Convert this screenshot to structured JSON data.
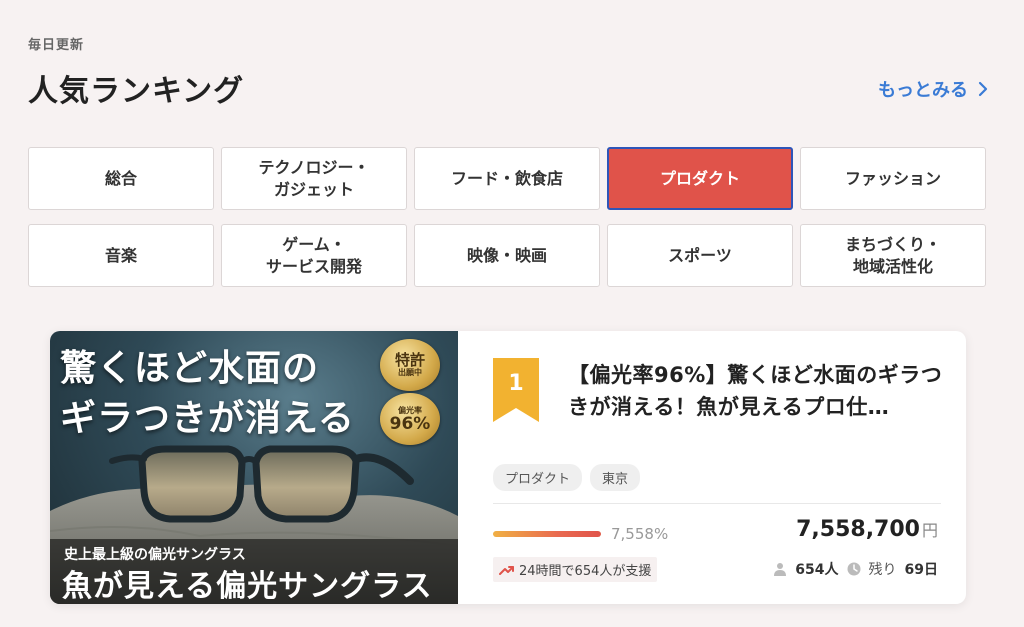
{
  "header": {
    "subtitle": "毎日更新",
    "title": "人気ランキング",
    "more_label": "もっとみる"
  },
  "categories": [
    {
      "label": "総合",
      "active": false
    },
    {
      "label": "テクノロジー・\nガジェット",
      "active": false
    },
    {
      "label": "フード・飲食店",
      "active": false
    },
    {
      "label": "プロダクト",
      "active": true
    },
    {
      "label": "ファッション",
      "active": false
    },
    {
      "label": "音楽",
      "active": false
    },
    {
      "label": "ゲーム・\nサービス開発",
      "active": false
    },
    {
      "label": "映像・映画",
      "active": false
    },
    {
      "label": "スポーツ",
      "active": false
    },
    {
      "label": "まちづくり・\n地域活性化",
      "active": false
    }
  ],
  "project": {
    "rank": "1",
    "title": "【偏光率96%】驚くほど水面のギラつきが消える！魚が見えるプロ仕…",
    "tags": [
      "プロダクト",
      "東京"
    ],
    "percent_label": "7,558%",
    "progress_fraction": 1.0,
    "amount": "7,558,700",
    "amount_unit": "円",
    "support_text": "24時間で654人が支援",
    "supporters": "654人",
    "remaining_label": "残り",
    "remaining_days": "69日",
    "image": {
      "headline1": "驚くほど水面の",
      "headline2": "ギラつきが消える",
      "seal1_main": "特許",
      "seal1_sub": "出願中",
      "seal2_sub": "偏光率",
      "seal2_main": "96%",
      "banner_small": "史上最上級の偏光サングラス",
      "banner_big": "魚が見える偏光サングラス"
    }
  },
  "colors": {
    "accent": "#e0534a",
    "link": "#3a7bd5",
    "rank_badge": "#f2b230",
    "active_border": "#2f55b8"
  }
}
